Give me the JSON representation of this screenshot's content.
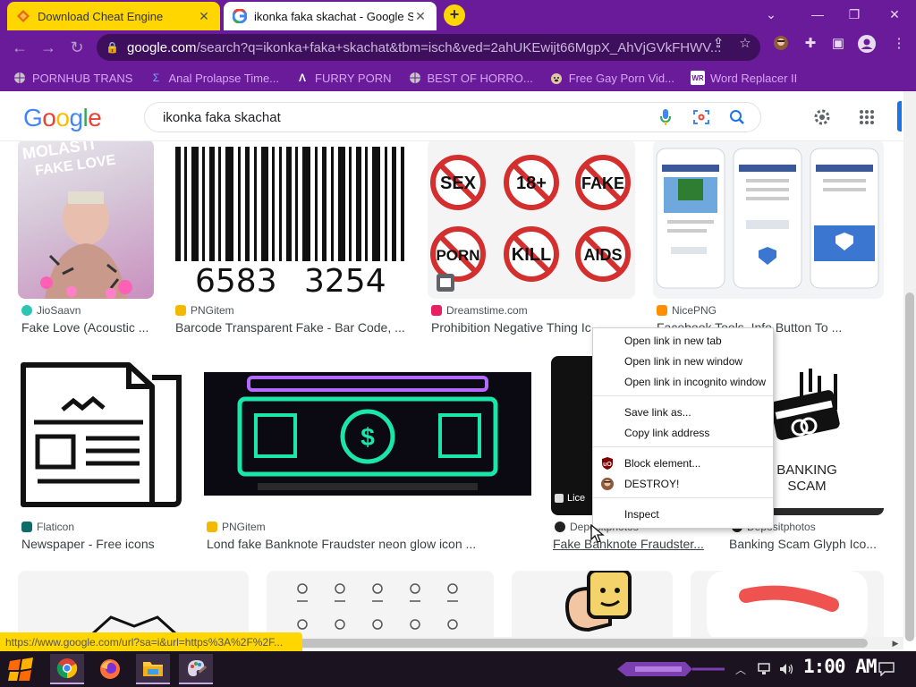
{
  "tabs": [
    {
      "title": "Download Cheat Engine",
      "active": false
    },
    {
      "title": "ikonka faka skachat - Google Se",
      "active": true
    }
  ],
  "window_controls": {
    "chevron": "⌄",
    "minimize": "—",
    "restore": "❐",
    "close": "✕"
  },
  "address_bar": {
    "host": "google.com",
    "path": "/search?q=ikonka+faka+skachat&tbm=isch&ved=2ahUKEwijt66MgpX_AhVjGVkFHWV..."
  },
  "bookmarks": [
    {
      "label": "PORNHUB TRANS",
      "icon": "globe-icon"
    },
    {
      "label": "Anal Prolapse Time...",
      "icon": "sigma-icon"
    },
    {
      "label": "FURRY PORN",
      "icon": "lambda-icon"
    },
    {
      "label": "BEST OF HORRO...",
      "icon": "globe-icon"
    },
    {
      "label": "Free Gay Porn Vid...",
      "icon": "dog-icon"
    },
    {
      "label": "Word Replacer II",
      "icon": "wr-icon"
    }
  ],
  "google": {
    "logo": "Google",
    "query": "ikonka faka skachat"
  },
  "results": {
    "row1": [
      {
        "source": "JioSaavn",
        "title": "Fake Love (Acoustic ...",
        "fav_color": "#2bc5b4"
      },
      {
        "source": "PNGitem",
        "title": "Barcode Transparent Fake - Bar Code, ...",
        "fav_color": "#f5b800",
        "barcode_left": "6583",
        "barcode_right": "3254"
      },
      {
        "source": "Dreamstime.com",
        "title": "Prohibition Negative Thing Ic...",
        "fav_color": "#e91e63",
        "signs": [
          "SEX",
          "18+",
          "FAKE",
          "PORN",
          "KILL",
          "AIDS"
        ]
      },
      {
        "source": "NicePNG",
        "title": "Facebook Tools, Info Button To ...",
        "fav_color": "#ff8f00"
      }
    ],
    "row2": [
      {
        "source": "Flaticon",
        "title": "Newspaper - Free icons",
        "fav_color": "#0d6b6b"
      },
      {
        "source": "PNGitem",
        "title": "Lond fake Banknote Fraudster neon glow icon ...",
        "fav_color": "#f5b800"
      },
      {
        "source": "Depositphotos",
        "title": "Fake Banknote Fraudster...",
        "fav_color": "#222",
        "badge": "Lice"
      },
      {
        "source": "Depositphotos",
        "title": "Banking Scam Glyph Ico...",
        "fav_color": "#222",
        "caption": "BANKING\nSCAM",
        "caption_line1": "BANKING",
        "caption_line2": "SCAM"
      }
    ]
  },
  "context_menu": {
    "items": [
      {
        "label": "Open link in new tab"
      },
      {
        "label": "Open link in new window"
      },
      {
        "label": "Open link in incognito window"
      },
      {
        "label": "Save link as..."
      },
      {
        "label": "Copy link address"
      },
      {
        "label": "Block element...",
        "icon": "ublock-icon"
      },
      {
        "label": "DESTROY!",
        "icon": "avatar-icon"
      },
      {
        "label": "Inspect"
      }
    ]
  },
  "status_url": "https://www.google.com/url?sa=i&url=https%3A%2F%2F...",
  "taskbar": {
    "clock": "1:00 AM",
    "apps": [
      "start-button",
      "chrome-icon",
      "firefox-icon",
      "file-explorer-icon",
      "paint-icon"
    ]
  }
}
